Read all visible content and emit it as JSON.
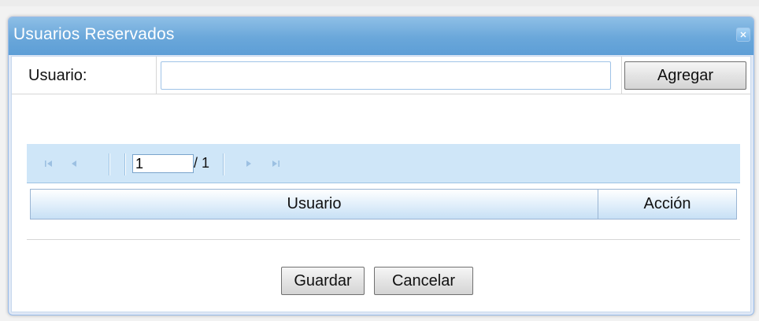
{
  "dialog": {
    "title": "Usuarios Reservados"
  },
  "form": {
    "user_label": "Usuario:",
    "user_value": "",
    "add_label": "Agregar"
  },
  "pager": {
    "current_page": "1",
    "total_pages": "/ 1",
    "icons": [
      "first-page-icon",
      "prev-page-icon",
      "next-page-icon",
      "last-page-icon"
    ]
  },
  "grid": {
    "columns": [
      "Usuario",
      "Acción"
    ],
    "rows": []
  },
  "footer": {
    "save_label": "Guardar",
    "cancel_label": "Cancelar"
  },
  "colors": {
    "title_bar": "#6aa7da",
    "toolbar": "#cfe6f8",
    "window_border": "#99bbe8"
  }
}
